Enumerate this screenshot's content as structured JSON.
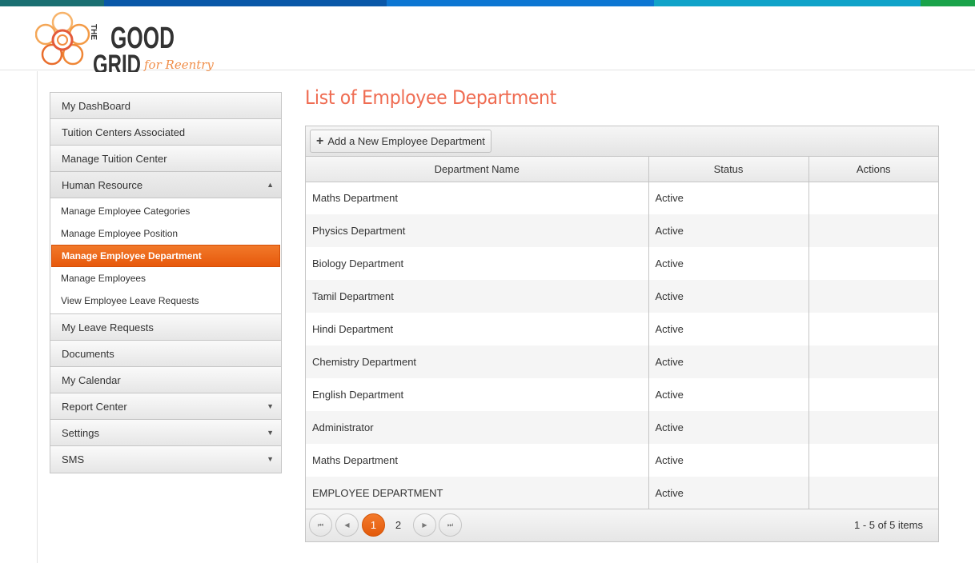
{
  "brand": {
    "logo_the": "THE",
    "logo_good": "GOOD",
    "logo_grid": "GRID",
    "logo_tagline": "for Reentry",
    "colors": {
      "orange": "#ef6c52",
      "accent": "#e9600f"
    }
  },
  "topbar_colors": [
    "#1b6f72",
    "#0a58a8",
    "#0c76d2",
    "#11a3c9",
    "#1aa34a"
  ],
  "sidebar": {
    "items": [
      {
        "label": "My DashBoard"
      },
      {
        "label": "Tuition Centers Associated"
      },
      {
        "label": "Manage Tuition Center"
      },
      {
        "label": "Human Resource",
        "arrow": "▲"
      },
      {
        "label": "My Leave Requests"
      },
      {
        "label": "Documents"
      },
      {
        "label": "My Calendar"
      },
      {
        "label": "Report Center",
        "arrow": "▼"
      },
      {
        "label": "Settings",
        "arrow": "▼"
      },
      {
        "label": "SMS",
        "arrow": "▼"
      }
    ],
    "submenu": [
      {
        "label": "Manage Employee Categories"
      },
      {
        "label": "Manage Employee Position"
      },
      {
        "label": "Manage Employee Department"
      },
      {
        "label": "Manage Employees"
      },
      {
        "label": "View Employee Leave Requests"
      }
    ]
  },
  "main": {
    "title": "List of Employee Department",
    "add_button": "Add a New Employee Department",
    "columns": [
      "Department Name",
      "Status",
      "Actions"
    ],
    "rows": [
      {
        "name": "Maths Department",
        "status": "Active"
      },
      {
        "name": "Physics Department",
        "status": "Active"
      },
      {
        "name": "Biology Department",
        "status": "Active"
      },
      {
        "name": "Tamil Department",
        "status": "Active"
      },
      {
        "name": "Hindi Department",
        "status": "Active"
      },
      {
        "name": "Chemistry Department",
        "status": "Active"
      },
      {
        "name": "English Department",
        "status": "Active"
      },
      {
        "name": "Administrator",
        "status": "Active"
      },
      {
        "name": "Maths Department",
        "status": "Active"
      },
      {
        "name": "EMPLOYEE DEPARTMENT",
        "status": "Active"
      }
    ],
    "pager": {
      "first": "⏮",
      "prev": "◀",
      "next": "▶",
      "last": "⏭",
      "pages": [
        "1",
        "2"
      ],
      "current": "1",
      "info": "1 - 5 of 5 items"
    }
  }
}
